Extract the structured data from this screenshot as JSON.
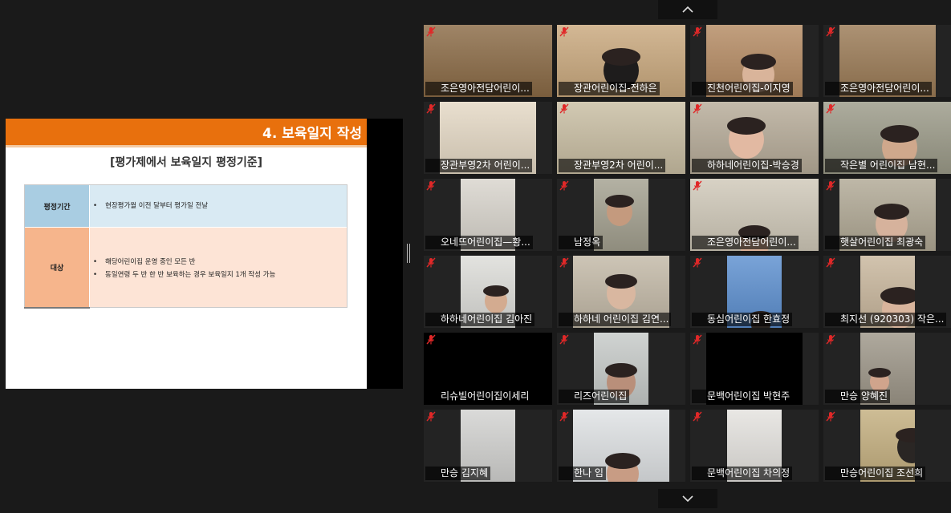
{
  "slide": {
    "title": "4. 보육일지 작성",
    "subtitle": "[평가제에서 보육일지 평정기준]",
    "row1_label": "평정기간",
    "row1_items": [
      "현장평가월 이전 달부터 평가일 전날"
    ],
    "row2_label": "대상",
    "row2_items": [
      "해당어린이집 운영 중인 모든 반",
      "동일연령 두 반 한 반 보육하는 경우 보육일지 1개 작성 가능"
    ]
  },
  "nav": {
    "up_icon": "chevron-up-icon",
    "down_icon": "chevron-down-icon"
  },
  "participants": [
    "조은영아전담어린이...",
    "장관어린이집-전하은",
    "진천어린이집-이지영",
    "조은영아전담어린이...",
    "장관부영2차 어린이...",
    "장관부영2차 어린이...",
    "하하네어린이집-박승경",
    "작은별 어린이집 남현...",
    "오네뜨어린이집—황...",
    "남정옥",
    "조은영아전담어린이...",
    "햇살어린이집 최광숙",
    "하하네어린이집 김아진",
    "하하네 어린이집 김연...",
    "동심어린이집 한효정",
    "최지선 (920303) 작은...",
    "리슈빌어린이집이세리",
    "리즈어린이집",
    "문백어린이집  박현주",
    "만승 양혜진",
    "만승 김지혜",
    "한나 임",
    "문백어린이집 차의정",
    "만승어린이집 조선희"
  ],
  "colors": {
    "header_orange": "#e8700d",
    "mute_red": "#e02828"
  }
}
